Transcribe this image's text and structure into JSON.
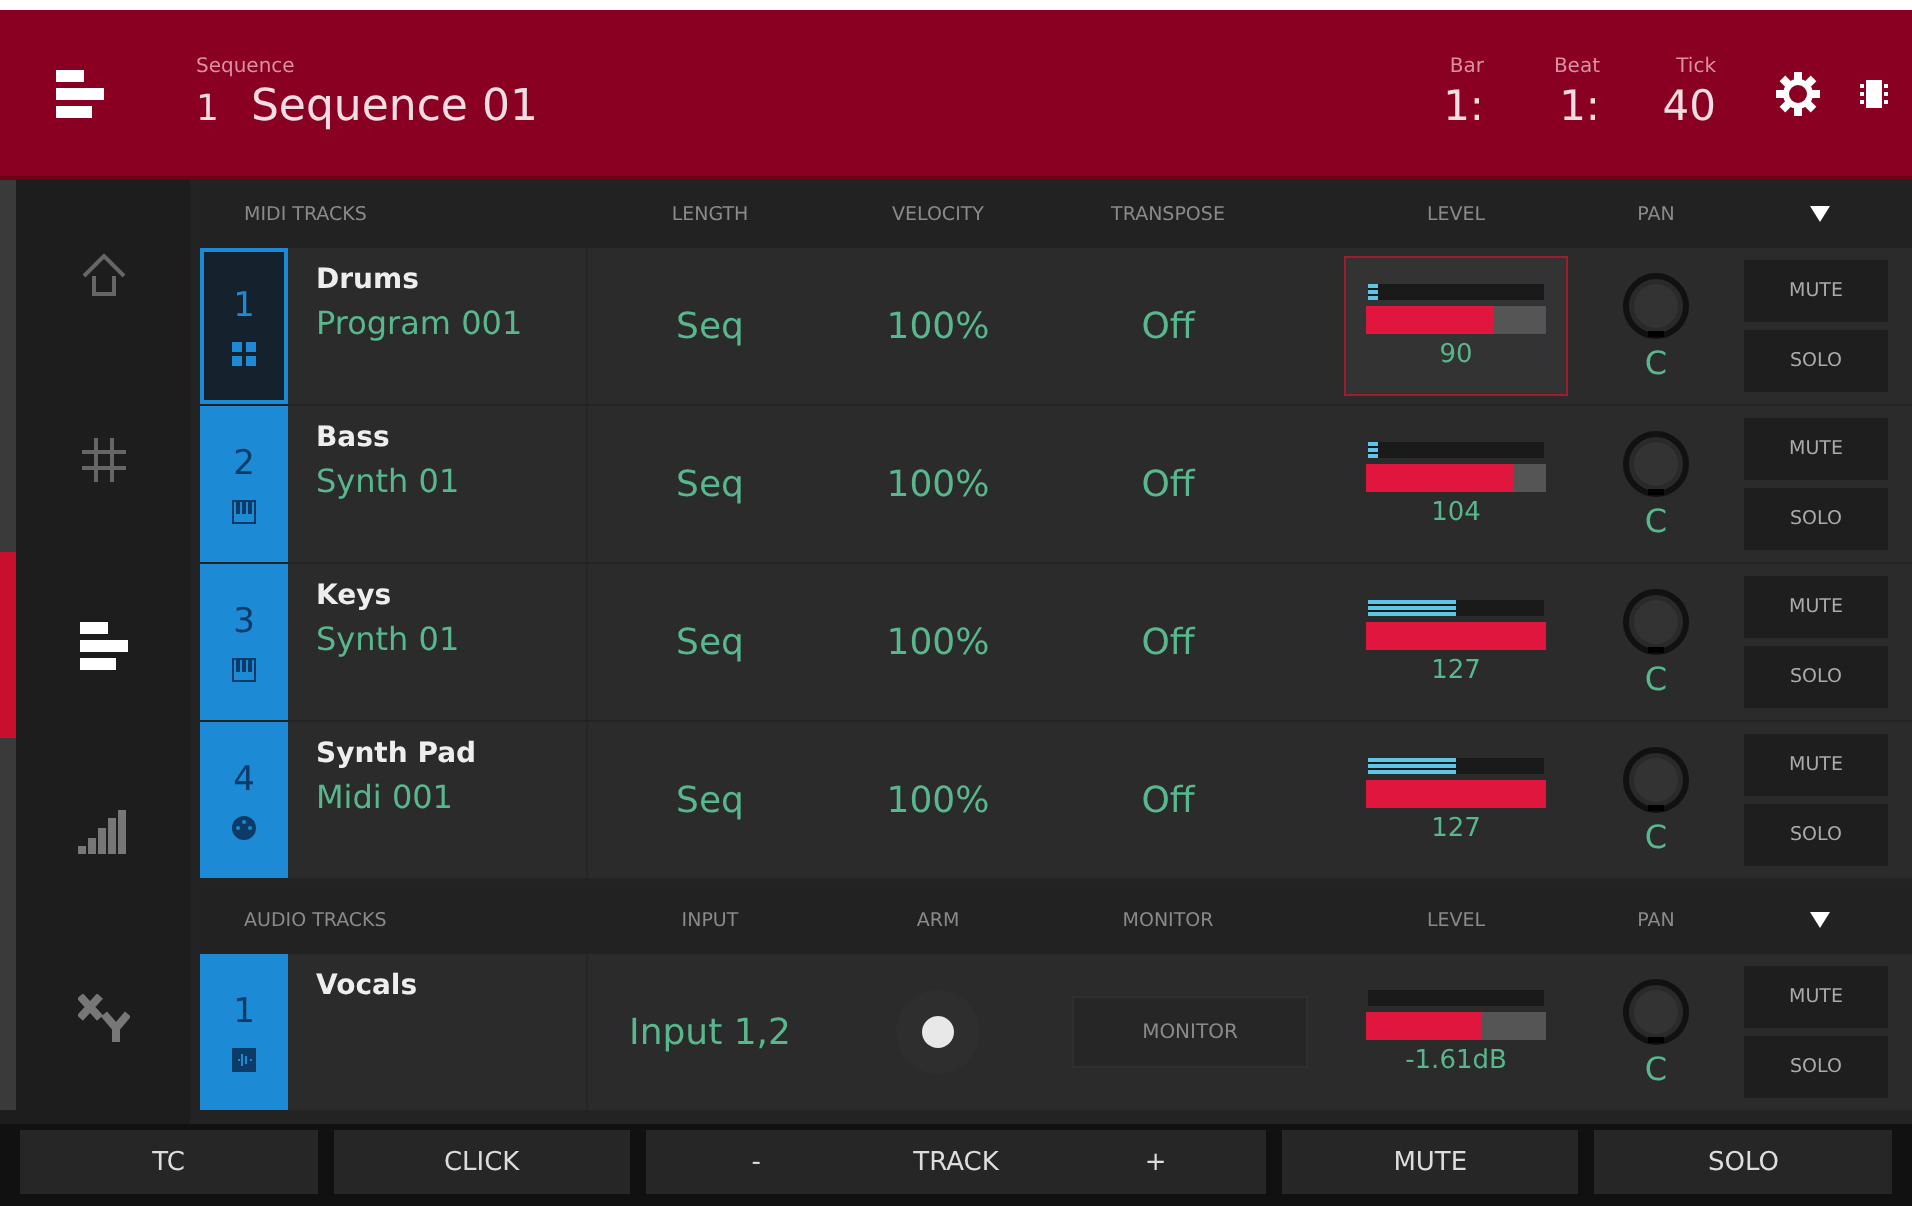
{
  "header": {
    "sequence_label": "Sequence",
    "sequence_number": "1",
    "sequence_name": "Sequence 01",
    "position": [
      {
        "label": "Bar",
        "value": "1:"
      },
      {
        "label": "Beat",
        "value": "1:"
      },
      {
        "label": "Tick",
        "value": "40"
      }
    ]
  },
  "sidebar": {
    "tabs": [
      {
        "kind": "arrow",
        "selected": false
      },
      {
        "kind": "grid",
        "selected": false
      },
      {
        "kind": "bars",
        "selected": true
      },
      {
        "kind": "signal",
        "selected": false
      },
      {
        "kind": "xy",
        "selected": false
      }
    ]
  },
  "midi_section": {
    "columns": [
      "MIDI TRACKS",
      "LENGTH",
      "VELOCITY",
      "TRANSPOSE",
      "LEVEL",
      "PAN"
    ],
    "tracks": [
      {
        "number": "1",
        "kind": "drum",
        "name": "Drums",
        "program": "Program 001",
        "length": "Seq",
        "velocity": "100%",
        "transpose": "Off",
        "meter": {
          "level": 0.06
        },
        "fader": {
          "level": 0.71
        },
        "level_reading": "90",
        "pan": "C",
        "buttons": [
          "MUTE",
          "SOLO"
        ],
        "selected": true
      },
      {
        "number": "2",
        "kind": "keys",
        "name": "Bass",
        "program": "Synth 01",
        "length": "Seq",
        "velocity": "100%",
        "transpose": "Off",
        "meter": {
          "level": 0.06
        },
        "fader": {
          "level": 0.82
        },
        "level_reading": "104",
        "pan": "C",
        "buttons": [
          "MUTE",
          "SOLO"
        ],
        "selected": false
      },
      {
        "number": "3",
        "kind": "keys",
        "name": "Keys",
        "program": "Synth 01",
        "length": "Seq",
        "velocity": "100%",
        "transpose": "Off",
        "meter": {
          "level": 0.5
        },
        "fader": {
          "level": 1
        },
        "level_reading": "127",
        "pan": "C",
        "buttons": [
          "MUTE",
          "SOLO"
        ],
        "selected": false
      },
      {
        "number": "4",
        "kind": "midi",
        "name": "Synth Pad",
        "program": "Midi 001",
        "length": "Seq",
        "velocity": "100%",
        "transpose": "Off",
        "meter": {
          "level": 0.5
        },
        "fader": {
          "level": 1
        },
        "level_reading": "127",
        "pan": "C",
        "buttons": [
          "MUTE",
          "SOLO"
        ],
        "selected": false
      }
    ]
  },
  "audio_section": {
    "columns": [
      "AUDIO TRACKS",
      "INPUT",
      "ARM",
      "MONITOR",
      "LEVEL",
      "PAN"
    ],
    "tracks": [
      {
        "number": "1",
        "kind": "audio",
        "name": "Vocals",
        "input": "Input 1,2",
        "monitor": "MONITOR",
        "fader": {
          "level": 0.64
        },
        "level_reading": "-1.61dB",
        "pan": "C",
        "buttons": [
          "MUTE",
          "SOLO"
        ],
        "selected": false
      }
    ]
  },
  "bottom_bar": [
    {
      "kind": "button",
      "label": "TC"
    },
    {
      "kind": "button",
      "label": "CLICK"
    },
    {
      "kind": "stepper",
      "minus": "-",
      "label": "TRACK",
      "plus": "+"
    },
    {
      "kind": "button",
      "label": "MUTE"
    },
    {
      "kind": "button",
      "label": "SOLO"
    }
  ]
}
